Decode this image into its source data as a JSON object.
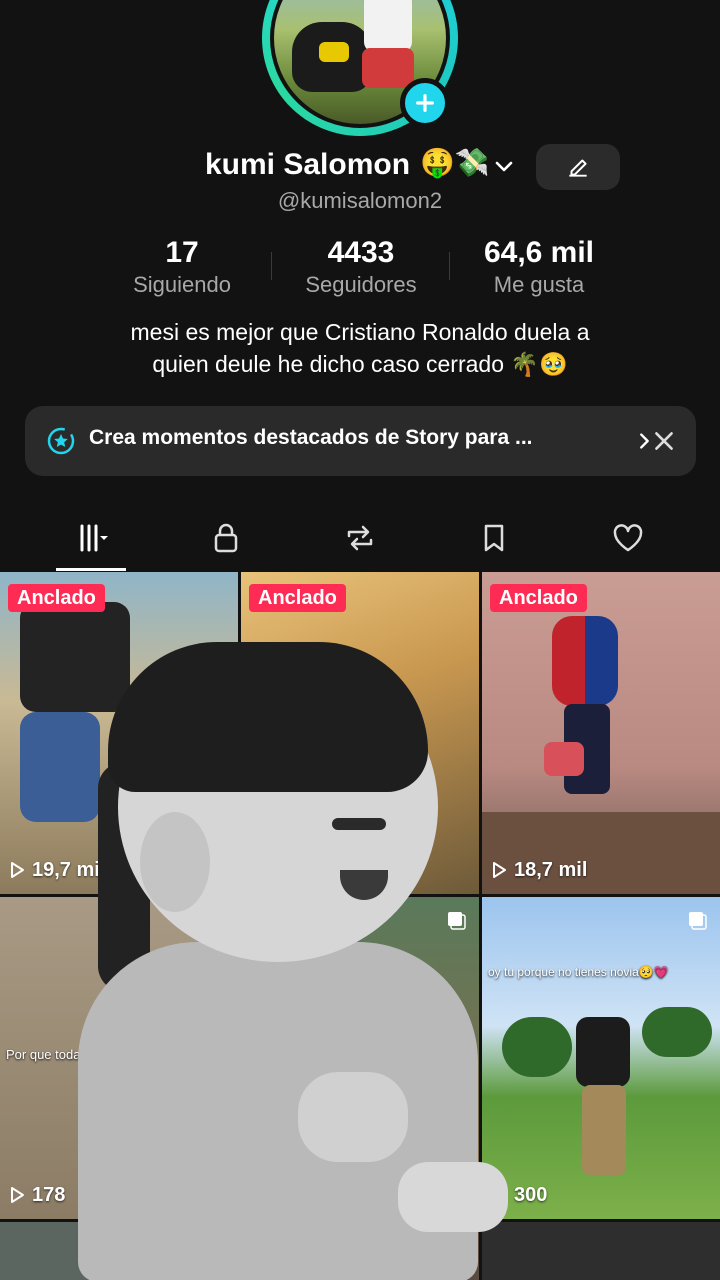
{
  "profile": {
    "display_name": "kumi Salomon",
    "name_emoji": "🤑💸",
    "handle": "@kumisalomon2",
    "bio_line1": "mesi es mejor que Cristiano Ronaldo duela a",
    "bio_line2": "quien deule he dicho caso cerrado 🌴🥹"
  },
  "stats": [
    {
      "value": "17",
      "label": "Siguiendo"
    },
    {
      "value": "4433",
      "label": "Seguidores"
    },
    {
      "value": "64,6 mil",
      "label": "Me gusta"
    }
  ],
  "story_banner": {
    "text": "Crea momentos destacados de Story para ..."
  },
  "tabs": [
    "videos-grid-icon",
    "lock-icon",
    "repost-icon",
    "bookmark-icon",
    "heart-icon"
  ],
  "videos": [
    {
      "pinned_label": "Anclado",
      "views": "19,7 mil"
    },
    {
      "pinned_label": "Anclado",
      "views": ""
    },
    {
      "pinned_label": "Anclado",
      "views": "18,7 mil"
    },
    {
      "views": "178",
      "caption": "Por que todas qui trabajo todo"
    },
    {
      "views": ""
    },
    {
      "views": "300",
      "caption": "oy tu porque no tienes novia🥺💗"
    }
  ],
  "colors": {
    "accent": "#20d5ec",
    "pin": "#fe2c55",
    "background": "#121212"
  }
}
